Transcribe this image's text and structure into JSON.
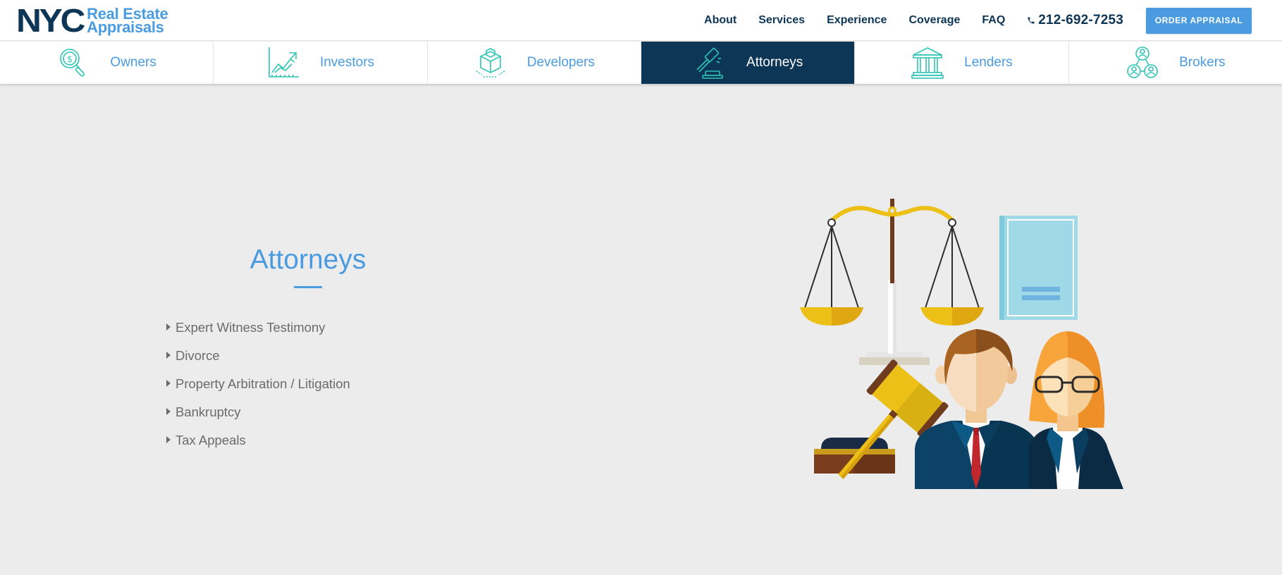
{
  "header": {
    "logo_primary": "NYC",
    "logo_line1": "Real Estate",
    "logo_line2": "Appraisals",
    "nav": [
      "About",
      "Services",
      "Experience",
      "Coverage",
      "FAQ"
    ],
    "phone": "212-692-7253",
    "order_button": "ORDER APPRAISAL"
  },
  "tabs": [
    {
      "label": "Owners",
      "icon": "magnifier-dollar-icon",
      "active": false
    },
    {
      "label": "Investors",
      "icon": "growth-chart-icon",
      "active": false
    },
    {
      "label": "Developers",
      "icon": "cube-icon",
      "active": false
    },
    {
      "label": "Attorneys",
      "icon": "gavel-icon",
      "active": true
    },
    {
      "label": "Lenders",
      "icon": "bank-icon",
      "active": false
    },
    {
      "label": "Brokers",
      "icon": "network-people-icon",
      "active": false
    }
  ],
  "content": {
    "title": "Attorneys",
    "services": [
      "Expert Witness Testimony",
      "Divorce",
      "Property Arbitration / Litigation",
      "Bankruptcy",
      "Tax Appeals"
    ],
    "illustration": "scales-of-justice-gavel-attorneys-illustration"
  },
  "colors": {
    "navy": "#0d3556",
    "accent_blue": "#4a9be0",
    "teal_icons": "#2ec4b6",
    "background": "#ececec"
  }
}
